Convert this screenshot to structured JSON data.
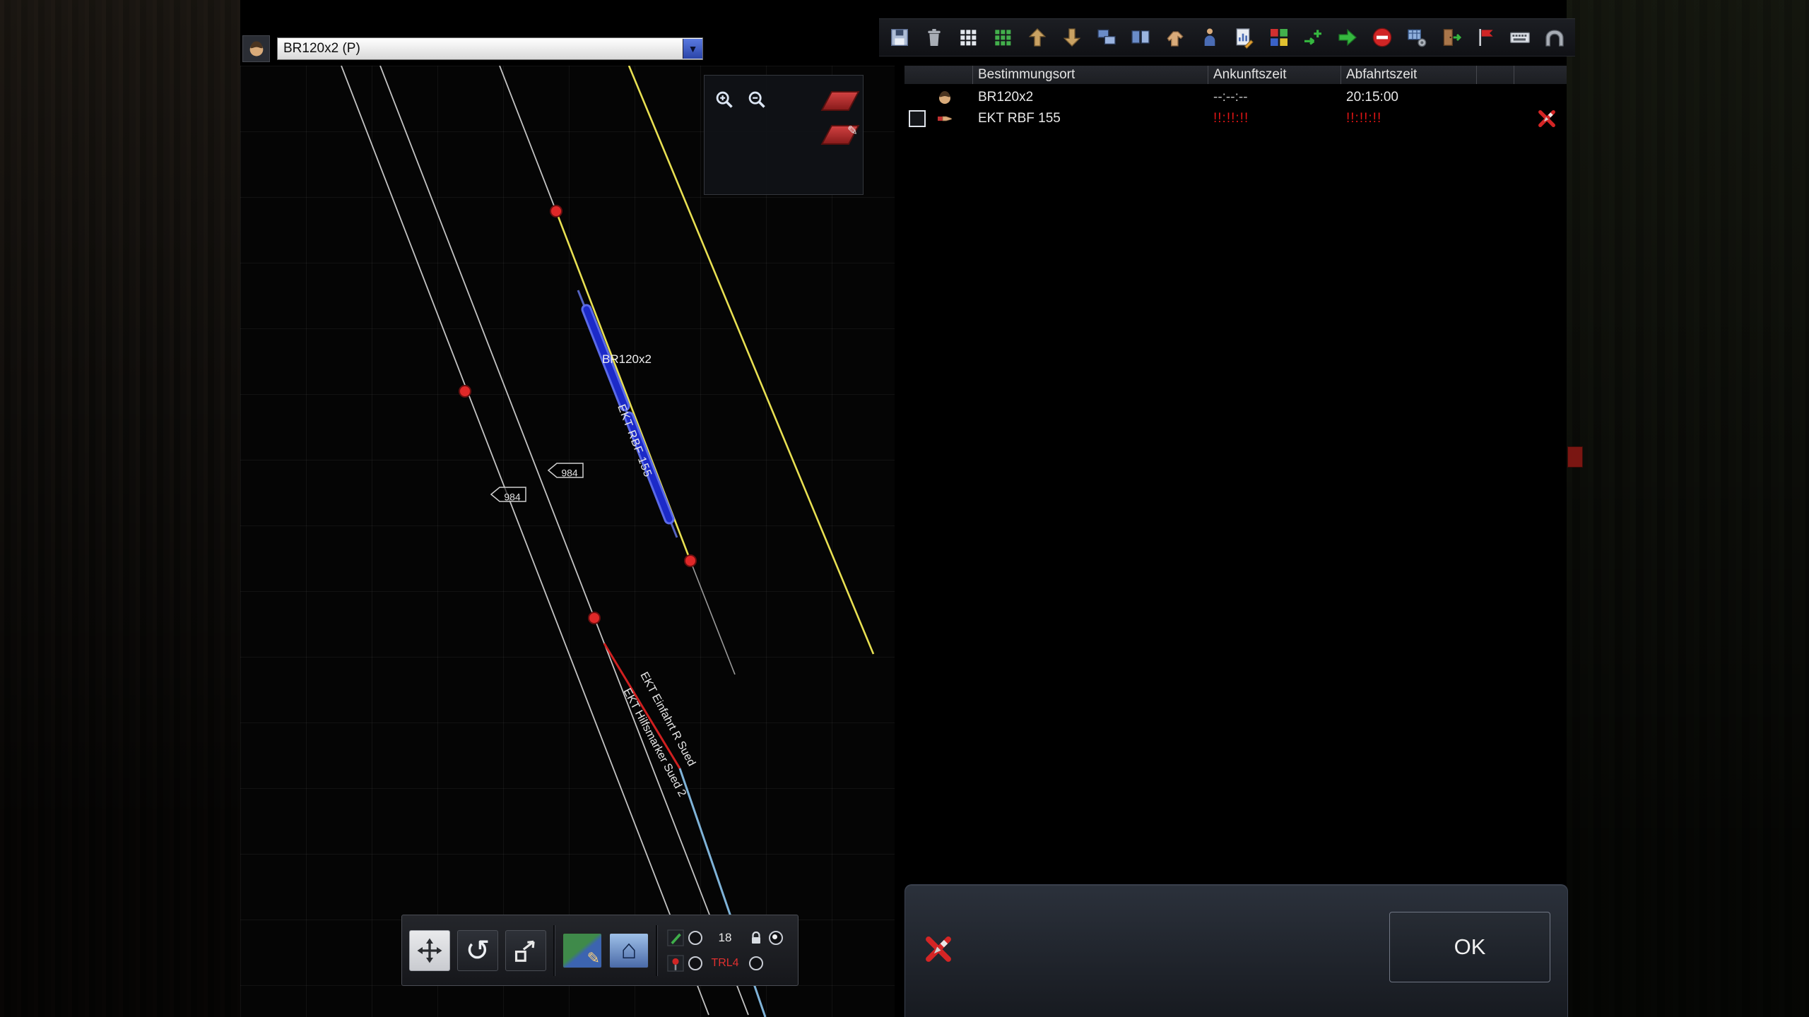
{
  "train_selector": {
    "value": "BR120x2 (P)"
  },
  "map": {
    "train_label": "BR120x2",
    "train_track_label": "EKT RBF 155",
    "signal_label_a": "984",
    "signal_label_b": "984",
    "entry_label": "EKT Einfahrt R Sued",
    "marker_label": "EKT Hilfsmarker Sued 2"
  },
  "map_toolbar": {
    "tip_value": "18",
    "signal_value": "TRL4",
    "icons": [
      "pan-icon",
      "rotate-icon",
      "transform-icon",
      "map-edit-icon",
      "home-icon",
      "edit-green-icon",
      "signal-red-icon",
      "lock-icon"
    ]
  },
  "zoom_panel_icons": [
    "zoom-in-icon",
    "zoom-out-icon",
    "signal-plate-icon",
    "signal-plate-edit-icon"
  ],
  "right_toolbar_icons": [
    "save-icon",
    "delete-icon",
    "grid-small-icon",
    "grid-green-icon",
    "load-up-icon",
    "unload-down-icon",
    "copy-view-icon",
    "dual-view-icon",
    "hand-icon",
    "passenger-icon",
    "edit-chart-icon",
    "color-tiles-icon",
    "route-add-icon",
    "go-arrow-icon",
    "no-entry-icon",
    "settings-table-icon",
    "exit-door-icon",
    "flag-icon",
    "keyboard-icon",
    "depot-icon"
  ],
  "schedule": {
    "columns": [
      "Bestimmungsort",
      "Ankunftszeit",
      "Abfahrtszeit"
    ],
    "rows": [
      {
        "name": "BR120x2",
        "arrival": "--:--:--",
        "departure": "20:15:00",
        "icon": "train-driver-icon"
      },
      {
        "name": "EKT RBF 155",
        "arrival": "!!:!!:!!",
        "departure": "!!:!!:!!",
        "icon": "pointing-hand-icon",
        "action": "remove-icon"
      }
    ]
  },
  "dialog": {
    "ok_label": "OK"
  },
  "colors": {
    "track_yellow": "#e8e052",
    "train_blue": "#1c2ac8",
    "signal_red": "#e02828",
    "warning_red": "#e01515",
    "accent_blue": "#3c5cc0"
  }
}
